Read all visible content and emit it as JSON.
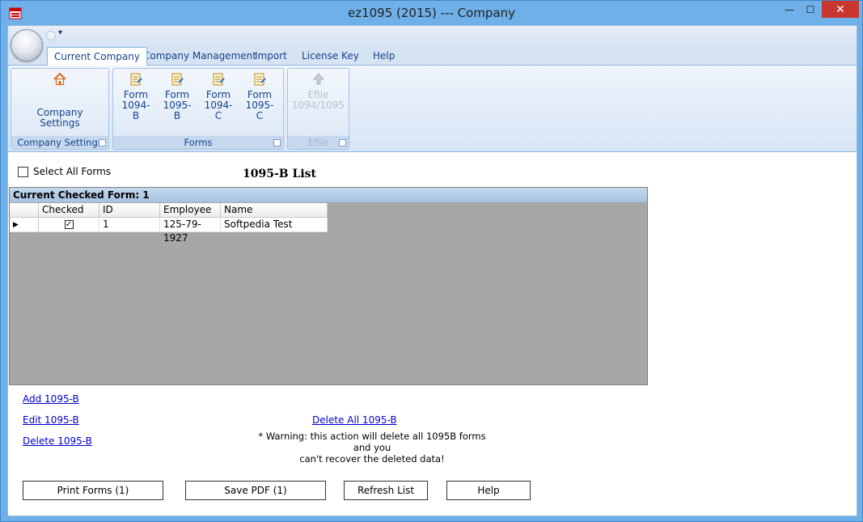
{
  "window": {
    "title": "ez1095 (2015) --- Company",
    "minimize_glyph": "—",
    "maximize_glyph": "☐",
    "close_glyph": "✕"
  },
  "ribbon": {
    "tabs": [
      {
        "label": "Current Company"
      },
      {
        "label": "Company Management"
      },
      {
        "label": "Import"
      },
      {
        "label": "License Key"
      },
      {
        "label": "Help"
      }
    ],
    "groups": {
      "company_settings": {
        "label": "Company Settings",
        "button_line1": "Company",
        "button_line2": "Settings"
      },
      "forms": {
        "label": "Forms",
        "buttons": [
          {
            "line1": "Form",
            "line2": "1094-B"
          },
          {
            "line1": "Form",
            "line2": "1095-B"
          },
          {
            "line1": "Form",
            "line2": "1094-C"
          },
          {
            "line1": "Form",
            "line2": "1095-C"
          }
        ]
      },
      "efile": {
        "label": "Efile",
        "button_line1": "Efile",
        "button_line2": "1094/1095"
      }
    }
  },
  "main": {
    "select_all_label": "Select All Forms",
    "select_all_checked": false,
    "list_title": "1095-B List",
    "grid_caption": "Current Checked Form: 1",
    "columns": [
      "Checked",
      "ID",
      "Employee SS",
      "Name"
    ],
    "rows": [
      {
        "checked": true,
        "id": "1",
        "employee_ss": "125-79-1927",
        "name": "Softpedia Test"
      }
    ]
  },
  "links": {
    "add": "Add 1095-B",
    "edit": "Edit 1095-B",
    "delete": "Delete 1095-B",
    "delete_all": "Delete All 1095-B"
  },
  "warning": {
    "line1": "* Warning: this action will delete all 1095B forms and you",
    "line2": "can't recover the deleted data!"
  },
  "buttons": {
    "print": "Print Forms (1)",
    "save_pdf": "Save PDF (1)",
    "refresh": "Refresh List",
    "help": "Help"
  },
  "icons": {
    "app": "app-icon",
    "company_settings": "house-icon",
    "form": "form-document-icon",
    "efile": "upload-arrow-icon",
    "row_pointer": "row-pointer-icon",
    "checkmark": "checkmark-icon"
  },
  "colors": {
    "title_bar": "#6fb0e8",
    "close_button": "#c7372f",
    "ribbon_text": "#15428b",
    "grid_background": "#a7a7a7",
    "link": "#0000cc"
  }
}
